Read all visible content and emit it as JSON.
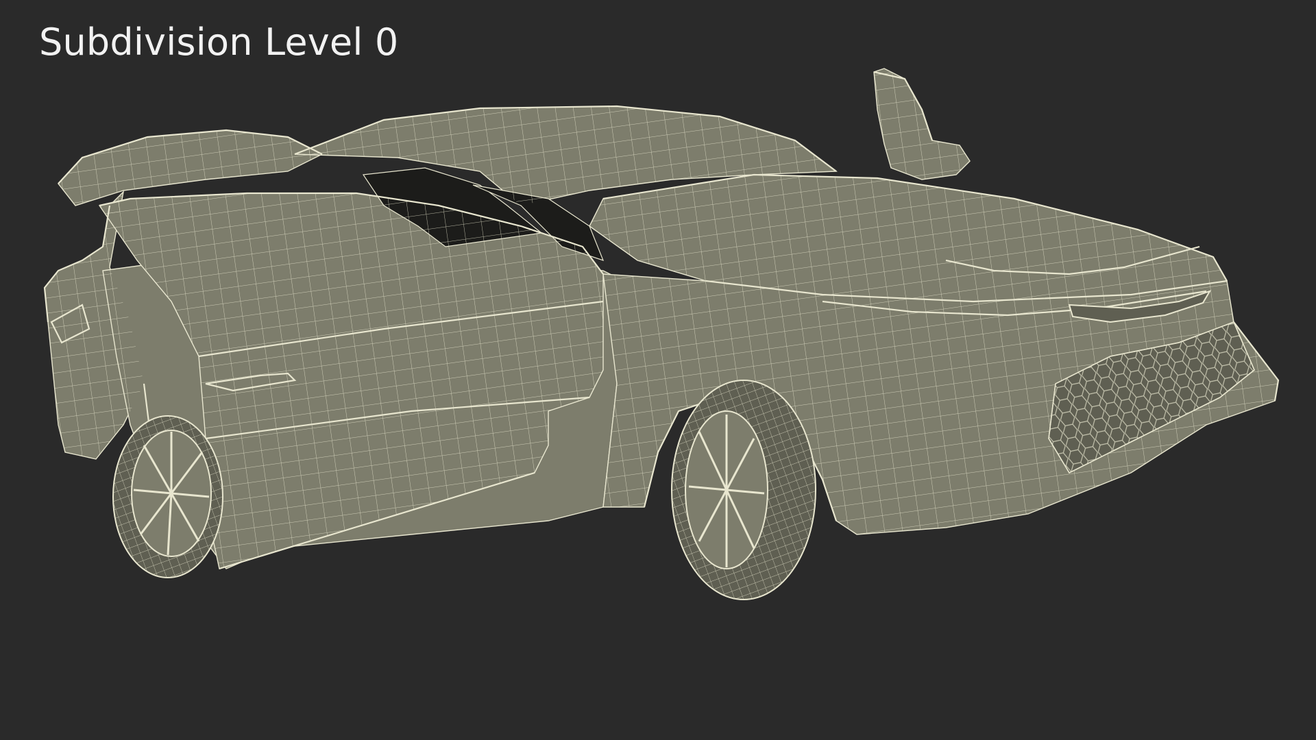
{
  "caption": {
    "text": "Subdivision Level 0"
  },
  "colors": {
    "background": "#2a2a2a",
    "caption_text": "#f2f2f2",
    "model_surface": "#7d7d6c",
    "model_surface_dark": "#5f5f52",
    "wire": "#e8e6cf",
    "cavity": "#1c1c1a"
  },
  "subject": {
    "icon": "car-wireframe-icon"
  }
}
